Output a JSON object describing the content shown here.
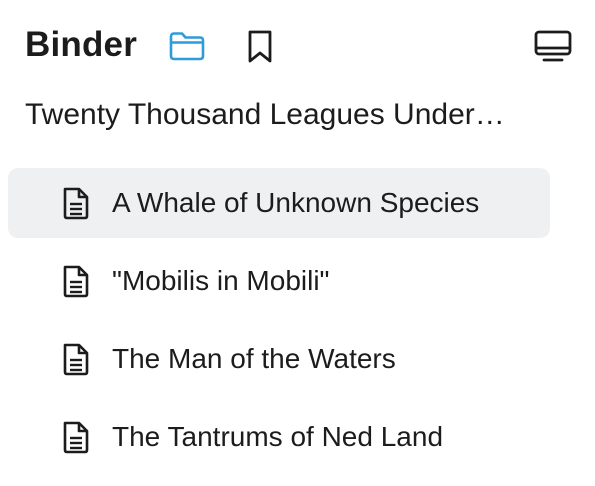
{
  "header": {
    "title": "Binder",
    "icons": [
      "folder-icon",
      "bookmark-icon",
      "desktop-icon"
    ],
    "accent_color": "#2d9cdb"
  },
  "project": {
    "title": "Twenty Thousand Leagues Under…"
  },
  "chapters": [
    {
      "label": "A Whale of Unknown Species",
      "icon": "document-icon",
      "selected": true
    },
    {
      "label": "\"Mobilis in Mobili\"",
      "icon": "document-icon",
      "selected": false
    },
    {
      "label": "The Man of the Waters",
      "icon": "document-icon",
      "selected": false
    },
    {
      "label": "The Tantrums of Ned Land",
      "icon": "document-icon",
      "selected": false
    }
  ],
  "colors": {
    "selected_background": "#eff0f2",
    "text": "#1c1c1c"
  }
}
